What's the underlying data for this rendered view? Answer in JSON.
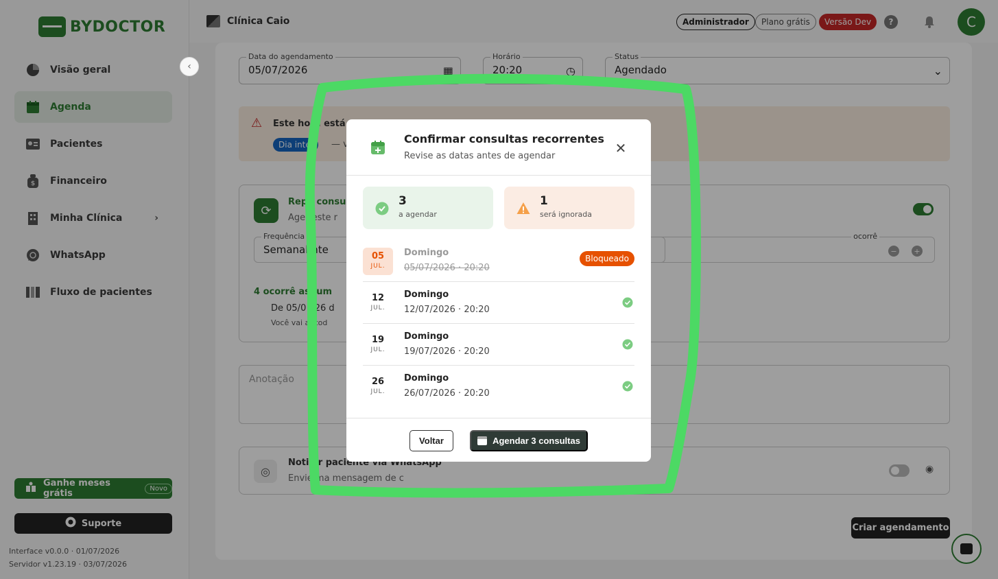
{
  "sidebar": {
    "logo_text": "BYDOCTOR",
    "collapse_icon": "chevron-left-icon",
    "items": [
      {
        "label": "Visão geral",
        "icon": "pie-chart-icon"
      },
      {
        "label": "Agenda",
        "icon": "calendar-icon",
        "active": true
      },
      {
        "label": "Pacientes",
        "icon": "id-card-icon"
      },
      {
        "label": "Financeiro",
        "icon": "money-bag-icon"
      },
      {
        "label": "Minha Clínica",
        "icon": "building-icon",
        "has_submenu": true
      },
      {
        "label": "WhatsApp",
        "icon": "whatsapp-icon"
      },
      {
        "label": "Fluxo de pacientes",
        "icon": "columns-icon"
      }
    ],
    "promo_label": "Ganhe meses grátis",
    "promo_badge": "Novo",
    "support_label": "Suporte",
    "interface_version": "Interface v0.0.0 · 01/07/2026",
    "server_version": "Servidor v1.23.19 · 03/07/2026"
  },
  "topbar": {
    "clinic_name": "Clínica Caio",
    "role_badge": "Administrador",
    "plan_badge": "Plano grátis",
    "version_badge": "Versão Dev",
    "help_label": "?",
    "avatar_letter": "C"
  },
  "form": {
    "date_label": "Data do agendamento",
    "date_value": "05/07/2026",
    "time_label": "Horário",
    "time_value": "20:20",
    "status_label": "Status",
    "status_value": "Agendado",
    "alert_title": "Este horá",
    "alert_title_tail": "está",
    "alert_chip": "Dia intei",
    "alert_extra": "— v",
    "repeat_title": "Repe",
    "repeat_title_tail": "consu",
    "repeat_sub": "Ager",
    "repeat_sub_tail": "este r",
    "freq_label": "Frequência",
    "freq_value": "Semanal",
    "freq_value_tail": "nte",
    "occ_label": "ocorrê",
    "occ_summary": "4 ocorrê",
    "occ_summary_tail": "as, um",
    "occ_range": "De 05/0",
    "occ_range_tail": "026 d",
    "occ_note": "Você vai",
    "occ_note_tail": "ar tod",
    "notes_placeholder": "Anotação",
    "notify_title": "Noti",
    "notify_title_tail": "ar paciente via WhatsApp",
    "notify_sub": "Envie",
    "notify_sub_tail": "ma mensagem de c",
    "create_label": "Criar agendamento"
  },
  "modal": {
    "title": "Confirmar consultas recorrentes",
    "subtitle": "Revise as datas antes de agendar",
    "stats": {
      "ok_count": "3",
      "ok_label": "a agendar",
      "warn_count": "1",
      "warn_label": "será ignorada"
    },
    "rows": [
      {
        "day": "05",
        "month": "JUL.",
        "weekday": "Domingo",
        "datetime": "05/07/2026 · 20:20",
        "blocked": true,
        "badge": "Bloqueado"
      },
      {
        "day": "12",
        "month": "JUL.",
        "weekday": "Domingo",
        "datetime": "12/07/2026 · 20:20",
        "blocked": false
      },
      {
        "day": "19",
        "month": "JUL.",
        "weekday": "Domingo",
        "datetime": "19/07/2026 · 20:20",
        "blocked": false
      },
      {
        "day": "26",
        "month": "JUL.",
        "weekday": "Domingo",
        "datetime": "26/07/2026 · 20:20",
        "blocked": false
      }
    ],
    "back_label": "Voltar",
    "confirm_label": "Agendar 3 consultas"
  },
  "colors": {
    "brand": "#2e7d32",
    "danger": "#c62828",
    "warning": "#e65100",
    "highlight_stroke": "#4cd964"
  }
}
